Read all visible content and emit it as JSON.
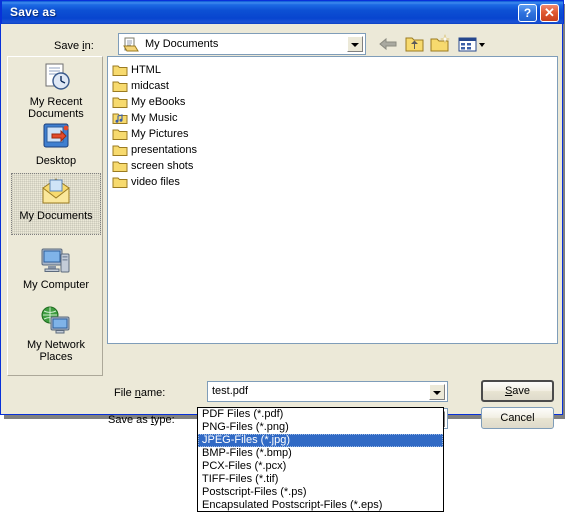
{
  "window": {
    "title": "Save as",
    "help_button": "?",
    "close_button": "✕",
    "titlebar_color": "#0a57d6",
    "face_color": "#ece9d8"
  },
  "toolbar": {
    "save_in_label_pre": "Save ",
    "save_in_label_mnemonic": "i",
    "save_in_label_post": "n:",
    "save_in_value": "My Documents",
    "buttons": [
      {
        "name": "back-button",
        "icon": "back-arrow-icon",
        "enabled": false
      },
      {
        "name": "up-one-level-button",
        "icon": "up-folder-icon",
        "enabled": true
      },
      {
        "name": "new-folder-button",
        "icon": "new-folder-icon",
        "enabled": true
      },
      {
        "name": "views-button",
        "icon": "views-icon",
        "enabled": true
      }
    ]
  },
  "places_bar": {
    "items": [
      {
        "label_line1": "My Recent",
        "label_line2": "Documents",
        "icon": "recent-documents-icon",
        "selected": false
      },
      {
        "label_line1": "Desktop",
        "label_line2": "",
        "icon": "desktop-icon",
        "selected": false
      },
      {
        "label_line1": "My Documents",
        "label_line2": "",
        "icon": "my-documents-icon",
        "selected": true
      },
      {
        "label_line1": "My Computer",
        "label_line2": "",
        "icon": "my-computer-icon",
        "selected": false
      },
      {
        "label_line1": "My Network",
        "label_line2": "Places",
        "icon": "network-places-icon",
        "selected": false
      }
    ]
  },
  "file_list": {
    "items": [
      {
        "name": "HTML",
        "icon": "folder-icon"
      },
      {
        "name": "midcast",
        "icon": "folder-icon"
      },
      {
        "name": "My eBooks",
        "icon": "folder-icon"
      },
      {
        "name": "My Music",
        "icon": "music-folder-icon"
      },
      {
        "name": "My Pictures",
        "icon": "folder-icon"
      },
      {
        "name": "presentations",
        "icon": "folder-icon"
      },
      {
        "name": "screen shots",
        "icon": "folder-icon"
      },
      {
        "name": "video files",
        "icon": "folder-icon"
      }
    ]
  },
  "fields": {
    "file_name_label_pre": "File ",
    "file_name_label_mnemonic": "n",
    "file_name_label_post": "ame:",
    "file_name_value": "test.pdf",
    "save_as_type_label_pre": "Save as ",
    "save_as_type_label_mnemonic": "t",
    "save_as_type_label_post": "ype:",
    "save_as_type_value": "PDF Files (*.pdf)"
  },
  "buttons": {
    "save_pre": "",
    "save_mnemonic": "S",
    "save_post": "ave",
    "cancel_label": "Cancel"
  },
  "dropdown": {
    "selected_index": 2,
    "highlight_color": "#316ac5",
    "options": [
      "PDF Files (*.pdf)",
      "PNG-Files (*.png)",
      "JPEG-Files (*.jpg)",
      "BMP-Files (*.bmp)",
      "PCX-Files (*.pcx)",
      "TIFF-Files (*.tif)",
      "Postscript-Files (*.ps)",
      "Encapsulated Postscript-Files (*.eps)"
    ]
  }
}
